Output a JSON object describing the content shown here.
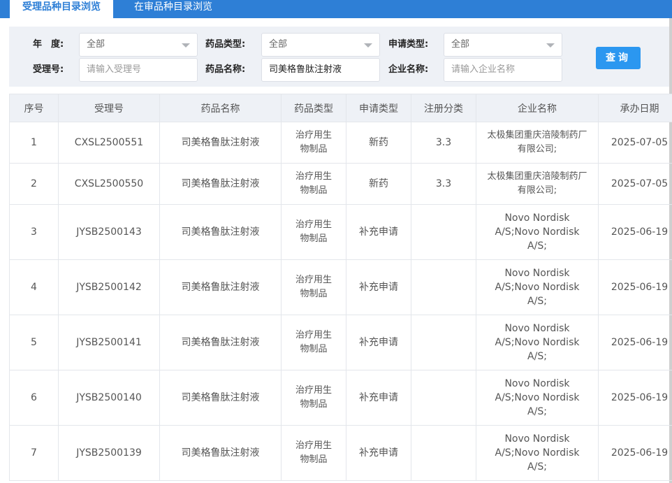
{
  "tabs": [
    {
      "label": "受理品种目录浏览",
      "active": true
    },
    {
      "label": "在审品种目录浏览",
      "active": false
    }
  ],
  "filters": {
    "year": {
      "label": "年　度:",
      "value": "全部"
    },
    "drug_type": {
      "label": "药品类型:",
      "value": "全部"
    },
    "apply_type": {
      "label": "申请类型:",
      "value": "全部"
    },
    "accept_no": {
      "label": "受理号:",
      "placeholder": "请输入受理号"
    },
    "drug_name": {
      "label": "药品名称:",
      "value": "司美格鲁肽注射液"
    },
    "company": {
      "label": "企业名称:",
      "placeholder": "请输入企业名称"
    },
    "query_label": "查询"
  },
  "table": {
    "headers": [
      "序号",
      "受理号",
      "药品名称",
      "药品类型",
      "申请类型",
      "注册分类",
      "企业名称",
      "承办日期"
    ],
    "rows": [
      {
        "no": "1",
        "accept_no": "CXSL2500551",
        "drug_name": "司美格鲁肽注射液",
        "drug_type": "治疗用生物制品",
        "apply_type": "新药",
        "reg_class": "3.3",
        "company": "太极集团重庆涪陵制药厂有限公司;",
        "date": "2025-07-05"
      },
      {
        "no": "2",
        "accept_no": "CXSL2500550",
        "drug_name": "司美格鲁肽注射液",
        "drug_type": "治疗用生物制品",
        "apply_type": "新药",
        "reg_class": "3.3",
        "company": "太极集团重庆涪陵制药厂有限公司;",
        "date": "2025-07-05"
      },
      {
        "no": "3",
        "accept_no": "JYSB2500143",
        "drug_name": "司美格鲁肽注射液",
        "drug_type": "治疗用生物制品",
        "apply_type": "补充申请",
        "reg_class": "",
        "company": "Novo Nordisk A/S;Novo Nordisk A/S;",
        "date": "2025-06-19"
      },
      {
        "no": "4",
        "accept_no": "JYSB2500142",
        "drug_name": "司美格鲁肽注射液",
        "drug_type": "治疗用生物制品",
        "apply_type": "补充申请",
        "reg_class": "",
        "company": "Novo Nordisk A/S;Novo Nordisk A/S;",
        "date": "2025-06-19"
      },
      {
        "no": "5",
        "accept_no": "JYSB2500141",
        "drug_name": "司美格鲁肽注射液",
        "drug_type": "治疗用生物制品",
        "apply_type": "补充申请",
        "reg_class": "",
        "company": "Novo Nordisk A/S;Novo Nordisk A/S;",
        "date": "2025-06-19"
      },
      {
        "no": "6",
        "accept_no": "JYSB2500140",
        "drug_name": "司美格鲁肽注射液",
        "drug_type": "治疗用生物制品",
        "apply_type": "补充申请",
        "reg_class": "",
        "company": "Novo Nordisk A/S;Novo Nordisk A/S;",
        "date": "2025-06-19"
      },
      {
        "no": "7",
        "accept_no": "JYSB2500139",
        "drug_name": "司美格鲁肽注射液",
        "drug_type": "治疗用生物制品",
        "apply_type": "补充申请",
        "reg_class": "",
        "company": "Novo Nordisk A/S;Novo Nordisk A/S;",
        "date": "2025-06-19"
      }
    ]
  }
}
